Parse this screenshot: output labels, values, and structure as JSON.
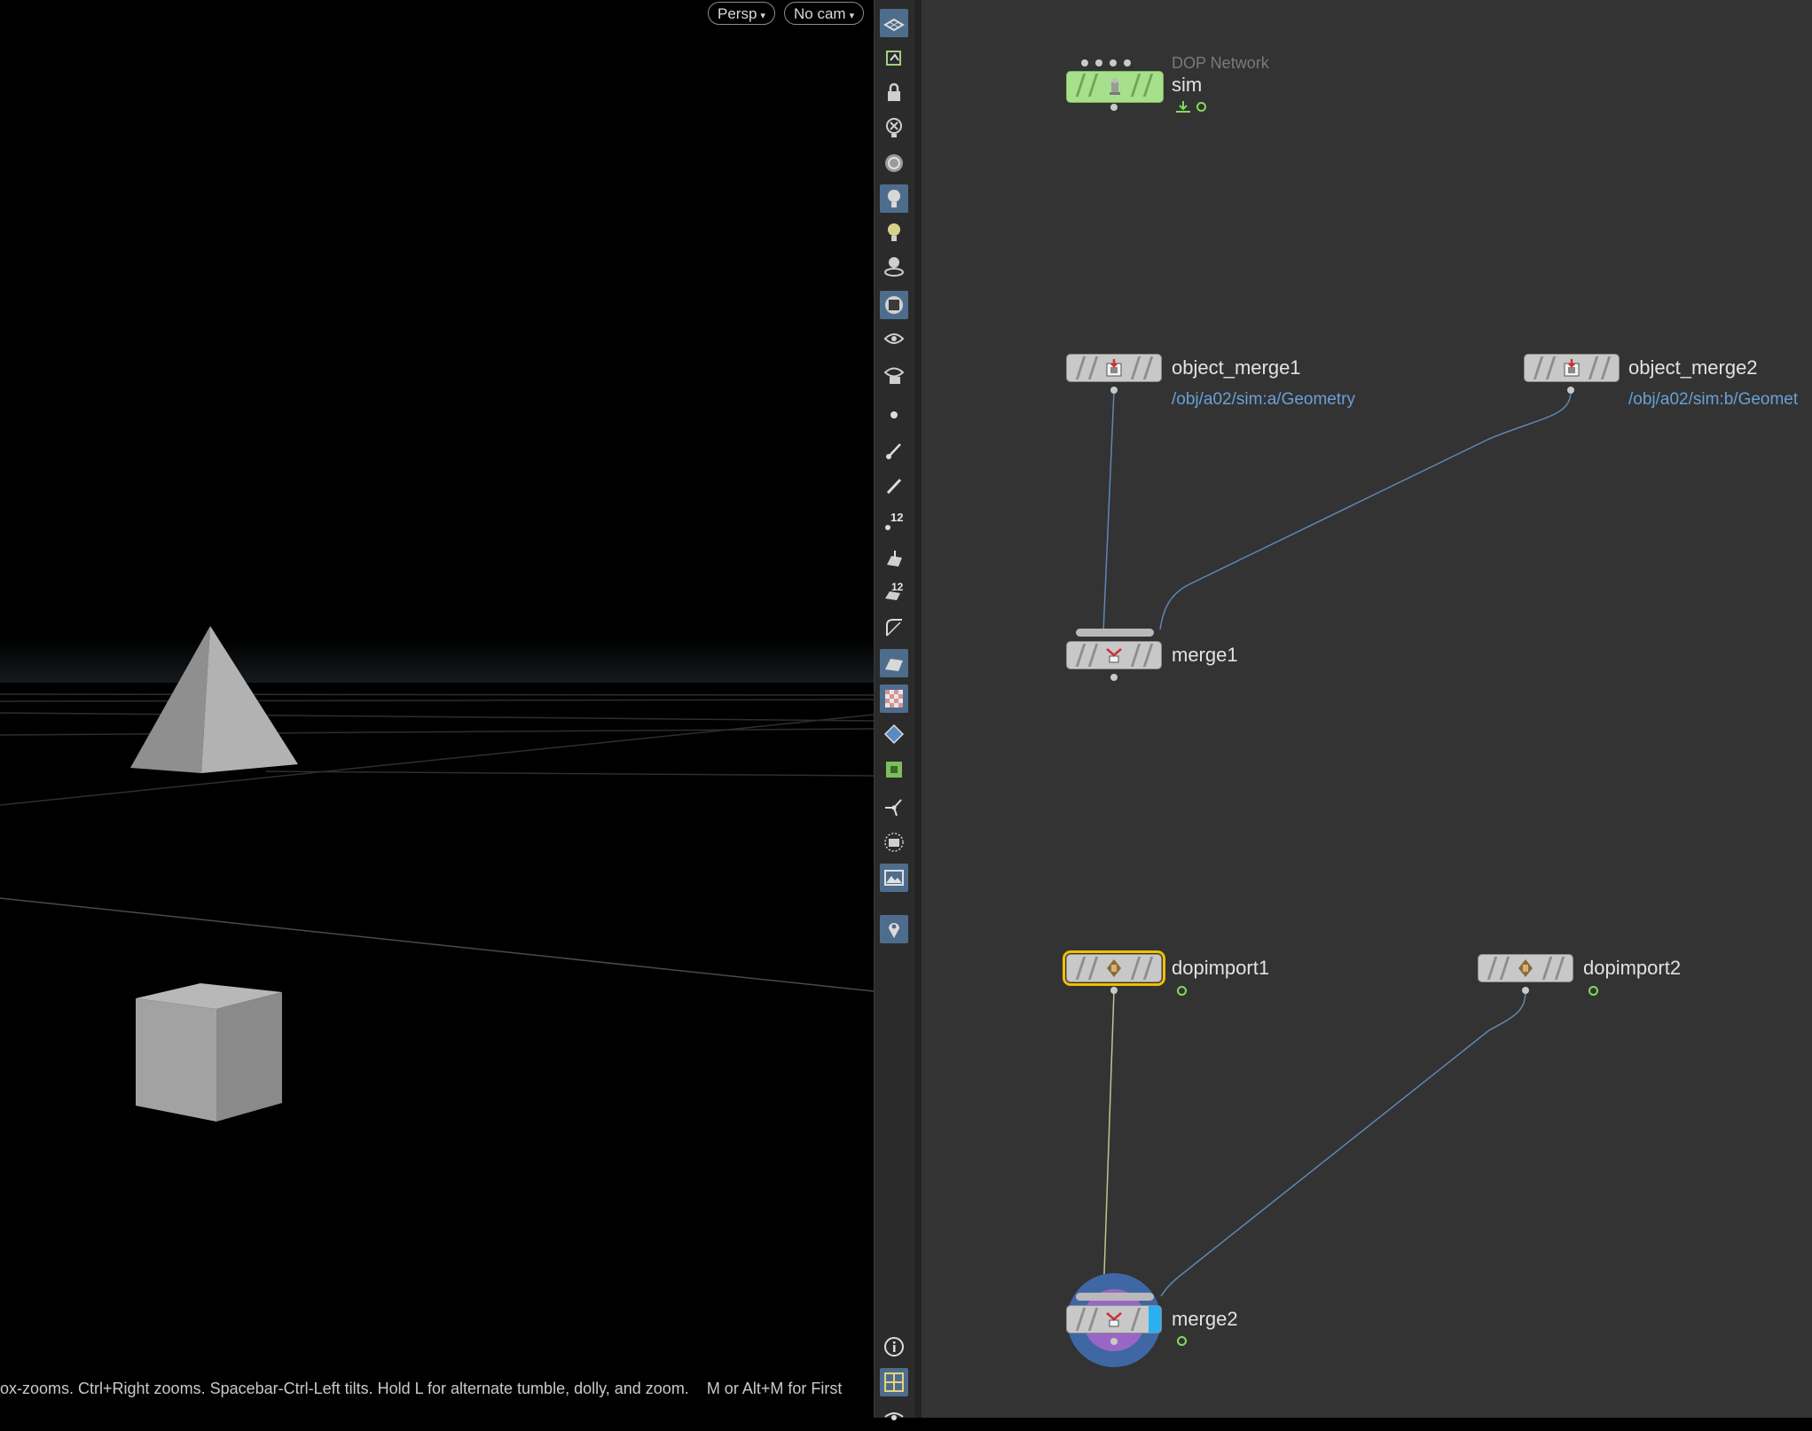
{
  "viewport": {
    "persp_label": "Persp",
    "cam_label": "No cam",
    "status_text": "ox-zooms. Ctrl+Right zooms. Spacebar-Ctrl-Left tilts. Hold L for alternate tumble, dolly, and zoom.    M or Alt+M for First",
    "objects": [
      "pyramid",
      "box"
    ]
  },
  "toolbar": {
    "items": [
      "wireframe-ground-icon",
      "snapshot-icon",
      "lock-icon",
      "hide-icon",
      "ghost-icon",
      "light-icon",
      "light-add-icon",
      "light-target-icon",
      "display-shaded-icon",
      "eye-icon",
      "camera-eye-icon",
      "point-icon",
      "brush-icon",
      "pen-icon",
      "point-numbers-icon",
      "prim-icon",
      "prim-numbers-icon",
      "edge-icon",
      "normals-icon",
      "checker-icon",
      "diamond-icon",
      "uv-icon",
      "handle-icon",
      "frame-icon",
      "background-image-icon",
      "pin-icon",
      "info-icon",
      "grid-layout-icon",
      "visibility-icon"
    ]
  },
  "network": {
    "sim": {
      "type_label": "DOP Network",
      "name": "sim"
    },
    "object_merge1": {
      "name": "object_merge1",
      "path": "/obj/a02/sim:a/Geometry"
    },
    "object_merge2": {
      "name": "object_merge2",
      "path": "/obj/a02/sim:b/Geomet"
    },
    "merge1": {
      "name": "merge1"
    },
    "dopimport1": {
      "name": "dopimport1"
    },
    "dopimport2": {
      "name": "dopimport2"
    },
    "merge2": {
      "name": "merge2"
    }
  },
  "colors": {
    "network_bg": "#333333",
    "node_gray": "#c8c8c8",
    "dop_green": "#a7e08a",
    "selected_outline": "#f0c000",
    "wire_blue": "#5f86b4",
    "wire_yellow": "#b6c98a",
    "path_link": "#6aa0d8"
  }
}
